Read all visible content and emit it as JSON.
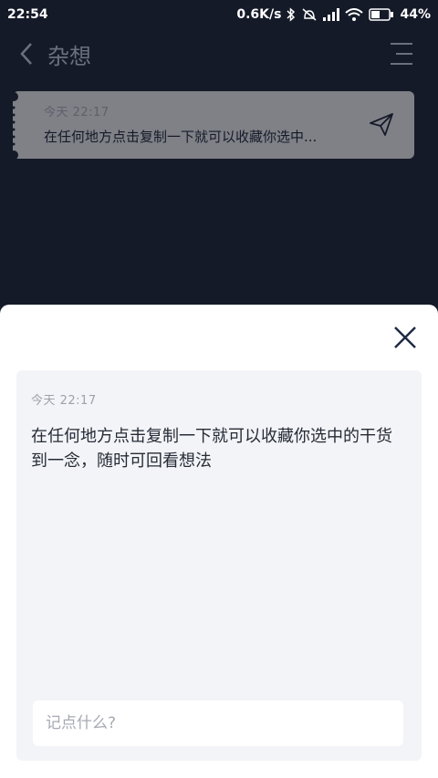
{
  "status_bar": {
    "time": "22:54",
    "net_speed": "0.6K/s",
    "battery": "44%"
  },
  "header": {
    "title": "杂想",
    "icons": [
      "back-arrow-icon",
      "menu-icon"
    ]
  },
  "note_card": {
    "time": "今天  22:17",
    "text": "在任何地方点击复制一下就可以收藏你选中...",
    "icon": "send-icon"
  },
  "sheet": {
    "close_icon": "close-icon",
    "note": {
      "time": "今天  22:17",
      "text": "在任何地方点击复制一下就可以收藏你选中的干货到一念，随时可回看想法"
    },
    "input": {
      "placeholder": "记点什么?",
      "value": ""
    }
  },
  "colors": {
    "background": "#151a28",
    "card": "#7f8187",
    "sheet": "#ffffff",
    "note_panel": "#f3f4f8"
  }
}
